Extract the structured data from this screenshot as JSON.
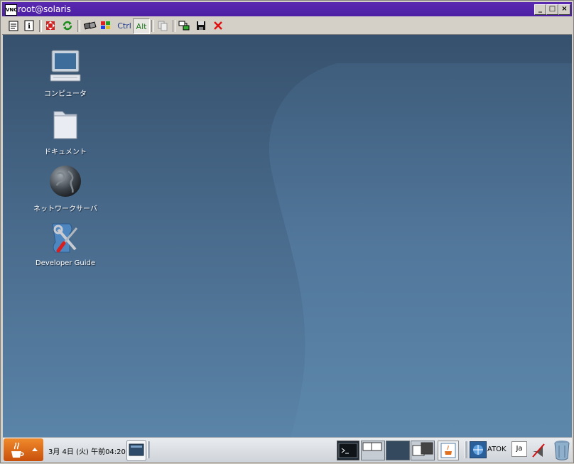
{
  "window": {
    "title": "root@solaris",
    "app_icon_text": "VNC",
    "minimize_label": "_",
    "maximize_label": "□",
    "close_label": "×"
  },
  "toolbar": {
    "ctrl_label": "Ctrl",
    "alt_label": "Alt"
  },
  "desktop": {
    "icons": [
      {
        "label": "コンピュータ",
        "icon": "computer-icon"
      },
      {
        "label": "ドキュメント",
        "icon": "folder-icon"
      },
      {
        "label": "ネットワークサーバ",
        "icon": "globe-icon"
      },
      {
        "label": "Developer Guide",
        "icon": "tools-icon"
      }
    ]
  },
  "taskbar": {
    "clock": "3月 4日 (火) 午前04:20",
    "atok_label": "ATOK",
    "lang_label": "Ja"
  },
  "colors": {
    "title_bar": "#4b1fa4",
    "desktop_top": "#36516d",
    "desktop_bottom": "#5a84a8",
    "java_button": "#e0701e"
  }
}
